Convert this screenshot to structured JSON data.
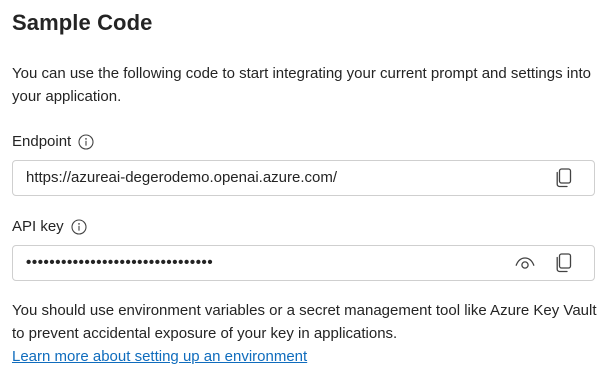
{
  "section": {
    "title": "Sample Code",
    "intro": "You can use the following code to start integrating your current prompt and settings into your application."
  },
  "endpoint": {
    "label": "Endpoint",
    "value": "https://azureai-degerodemo.openai.azure.com/",
    "info_icon": "info-icon",
    "copy_icon": "copy-icon"
  },
  "api_key": {
    "label": "API key",
    "value": "••••••••••••••••••••••••••••••••",
    "info_icon": "info-icon",
    "reveal_icon": "eye-icon",
    "copy_icon": "copy-icon"
  },
  "note": {
    "text": "You should use environment variables or a secret management tool like Azure Key Vault to prevent accidental exposure of your key in applications.",
    "link_text": "Learn more about setting up an environment"
  },
  "colors": {
    "text": "#242424",
    "link": "#0f6cbd",
    "border": "#cfcfcf"
  }
}
